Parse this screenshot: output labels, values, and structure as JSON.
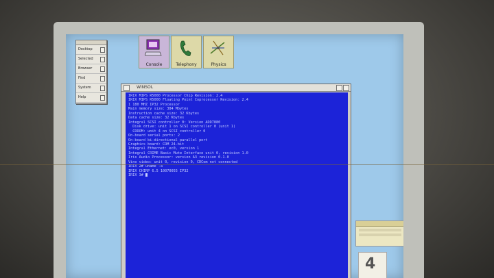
{
  "toolchest": {
    "items": [
      {
        "label": "Desktop"
      },
      {
        "label": "Selected"
      },
      {
        "label": "Browser"
      },
      {
        "label": "Find"
      },
      {
        "label": "System"
      },
      {
        "label": "Help"
      }
    ]
  },
  "desktop_icons": [
    {
      "label": "Console",
      "icon": "console-monitor-icon"
    },
    {
      "label": "Telephony",
      "icon": "phone-icon"
    },
    {
      "label": "Physics",
      "icon": "physics-icon"
    }
  ],
  "console": {
    "title": "WINSOL",
    "lines": [
      "IRIX MIPS R5000 Processor Chip Revision: 2.4",
      "IRIX MIPS R5000 Floating Point Coprocessor Revision: 2.4",
      "1 180 MHZ IP32 Processor",
      "Main memory size: 384 Mbytes",
      "Instruction cache size: 32 Kbytes",
      "Data cache size: 32 Kbytes",
      "Integral SCSI controller 0: Version ADD7880",
      "  Disk drive: unit 1 on SCSI controller 0 (unit 1)",
      "  CDROM: unit 4 on SCSI controller 0",
      "On-board serial ports: 2",
      "On-board bi-directional parallel port",
      "Graphics board: CRM 24-bit",
      "Integral Ethernet: ec0, version 1",
      "Integral CRIME Basic Mute Interface unit 0, revision 1.0",
      "Iris Audio Processor: version A3 revision 0.1.0",
      "Vino video: unit 0, revision 0, CDCom not connected",
      "IRIX 2# uname -a",
      "IRIX CHIRP 6.5 10070055 IP32"
    ],
    "prompt": "IRIX 3# "
  }
}
